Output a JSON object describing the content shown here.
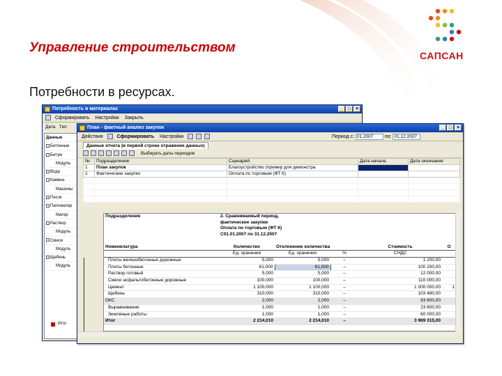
{
  "slide": {
    "title": "Управление строительством",
    "subtitle": "Потребности в ресурсах.",
    "logo_text": "САПСАН",
    "accent_color": "#cc0000"
  },
  "back_window": {
    "title": "Потребность в материалах",
    "toolbar": [
      "Сформировать",
      "Настройки",
      "Закрыть"
    ],
    "header_labels": [
      "Дата",
      "Тип"
    ],
    "tab": "Данные",
    "list_items": [
      {
        "label": "Бетонные",
        "sub": false
      },
      {
        "label": "Битум",
        "sub": false
      },
      {
        "label": "Модуль",
        "sub": true
      },
      {
        "label": "Вода",
        "sub": false
      },
      {
        "label": "Камень",
        "sub": false
      },
      {
        "label": "Машины",
        "sub": true
      },
      {
        "label": "Песок",
        "sub": false
      },
      {
        "label": "Пиломатер",
        "sub": false
      },
      {
        "label": "Матер",
        "sub": true
      },
      {
        "label": "Раствор",
        "sub": false
      },
      {
        "label": "Модуль",
        "sub": true
      },
      {
        "label": "Смеси",
        "sub": false
      },
      {
        "label": "Модуль",
        "sub": true
      },
      {
        "label": "Щебень",
        "sub": false
      },
      {
        "label": "Модуль",
        "sub": true
      }
    ],
    "footer_label": "Итог"
  },
  "front_window": {
    "title": "План - фактный анализ закупок",
    "toolbar": {
      "actions_label": "Действия",
      "generate_label": "Сформировать",
      "settings_label": "Настройки"
    },
    "period": {
      "label": "Период с:",
      "from": "01.2007",
      "to_label": "по:",
      "to": "01.12.2007"
    },
    "tab_label": "Данные отчета (в первой строке отражение данных)",
    "icon_bar_label": "Выбирать даты периодов",
    "periods_table": {
      "headers": [
        "№",
        "Подразделение",
        "Сценарий",
        "Дата начала",
        "Дата окончания"
      ],
      "rows": [
        [
          "1",
          "План закупок",
          "Благоустройство (пример для демонстра",
          "",
          ""
        ],
        [
          "2",
          "Фактические закупки",
          "Оплата по торговым (ФТ К)",
          "",
          ""
        ]
      ]
    },
    "report": {
      "col_headers_top": [
        "Подразделение",
        "2. Сравниваемый период,"
      ],
      "info_lines": [
        "фактические закупки",
        "Оплата по торговым (ФТ К)",
        "С01.01.2007 по 31.12.2007"
      ],
      "headers": [
        "Номенклатура",
        "Количество",
        "Отклонение количества",
        "",
        "Стоимость",
        "О"
      ],
      "subheaders": [
        "",
        "Ед. хранения",
        "Ед. хранения",
        "%",
        "СНДС",
        ""
      ],
      "rows": [
        {
          "name": "Плиты железобетонные дорожные",
          "qty": "5,000",
          "dev": "5,000",
          "pct": "–",
          "cost": "1 200,00",
          "o": "",
          "type": "row"
        },
        {
          "name": "Плиты бетонные",
          "qty": "61,000",
          "dev": "61,000",
          "pct": "–",
          "cost": "100 200,00",
          "o": "",
          "type": "row",
          "selected": true
        },
        {
          "name": "Раствор готовый",
          "qty": "5,000",
          "dev": "5,000",
          "pct": "–",
          "cost": "12 000,00",
          "o": "",
          "type": "row"
        },
        {
          "name": "Смеси асфальтобетонные дорожные",
          "qty": "100,000",
          "dev": "100,000",
          "pct": "–",
          "cost": "110 000,00",
          "o": "",
          "type": "row"
        },
        {
          "name": "Цемент",
          "qty": "1 100,000",
          "dev": "1 100,000",
          "pct": "–",
          "cost": "1 000 000,00",
          "o": "1",
          "type": "row"
        },
        {
          "name": "Щебень",
          "qty": "310,000",
          "dev": "310,000",
          "pct": "–",
          "cost": "103 480,00",
          "o": "",
          "type": "row"
        },
        {
          "name": "ОКС",
          "qty": "2,000",
          "dev": "2,000",
          "pct": "–",
          "cost": "83 600,00",
          "o": "",
          "type": "group"
        },
        {
          "name": "Выравнивание",
          "qty": "1,000",
          "dev": "1,000",
          "pct": "–",
          "cost": "23 600,00",
          "o": "",
          "type": "row"
        },
        {
          "name": "Земляные работы",
          "qty": "1,000",
          "dev": "1,000",
          "pct": "–",
          "cost": "60 000,00",
          "o": "",
          "type": "row"
        },
        {
          "name": "Итог",
          "qty": "2 214,010",
          "dev": "2 214,010",
          "pct": "–",
          "cost": "3 969 315,00",
          "o": "",
          "type": "total"
        }
      ]
    }
  }
}
